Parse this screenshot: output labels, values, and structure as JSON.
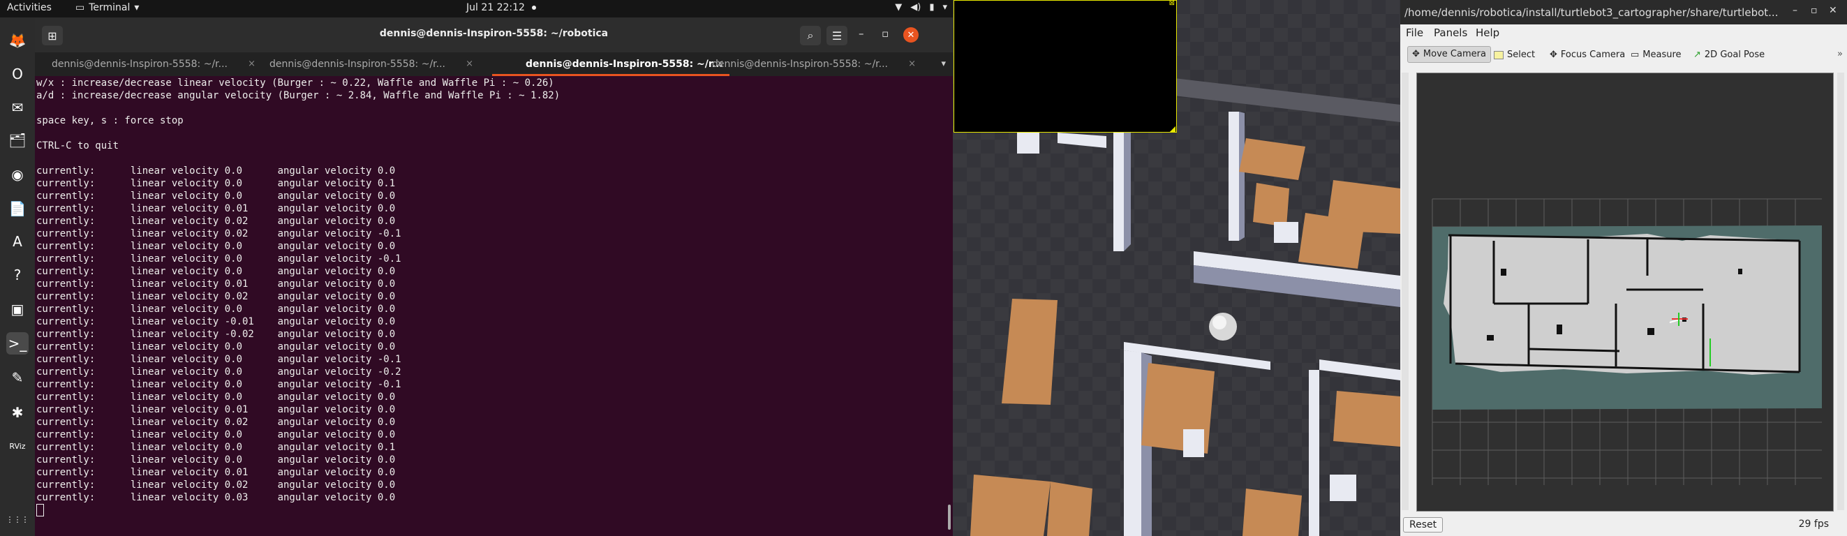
{
  "topbar": {
    "activities": "Activities",
    "app": "Terminal",
    "app_chevron": "▾",
    "clock": "Jul 21  22:12"
  },
  "dock": {
    "items": [
      {
        "name": "firefox-icon",
        "glyph": "🦊"
      },
      {
        "name": "opera-icon",
        "glyph": "O"
      },
      {
        "name": "thunderbird-icon",
        "glyph": "✉"
      },
      {
        "name": "files-icon",
        "glyph": "🗂"
      },
      {
        "name": "rhythmbox-icon",
        "glyph": "◉"
      },
      {
        "name": "writer-icon",
        "glyph": "📄"
      },
      {
        "name": "software-icon",
        "glyph": "A"
      },
      {
        "name": "help-icon",
        "glyph": "?"
      },
      {
        "name": "monitor-icon",
        "glyph": "▣"
      },
      {
        "name": "terminal-icon",
        "glyph": ">_"
      },
      {
        "name": "text-editor-icon",
        "glyph": "✎"
      },
      {
        "name": "gazebo-icon",
        "glyph": "✱"
      },
      {
        "name": "rviz-icon",
        "glyph": "RViz"
      },
      {
        "name": "show-apps-icon",
        "glyph": "⋮⋮⋮"
      }
    ]
  },
  "terminal": {
    "title": "dennis@dennis-Inspiron-5558: ~/robotica",
    "tabs": [
      "dennis@dennis-Inspiron-5558: ~/r...",
      "dennis@dennis-Inspiron-5558: ~/r...",
      "dennis@dennis-Inspiron-5558: ~/r...",
      "dennis@dennis-Inspiron-5558: ~/r..."
    ],
    "tab_close": "×",
    "lines": [
      "w/x : increase/decrease linear velocity (Burger : ~ 0.22, Waffle and Waffle Pi : ~ 0.26)",
      "a/d : increase/decrease angular velocity (Burger : ~ 2.84, Waffle and Waffle Pi : ~ 1.82)",
      "",
      "space key, s : force stop",
      "",
      "CTRL-C to quit",
      "",
      "currently:      linear velocity 0.0      angular velocity 0.0",
      "currently:      linear velocity 0.0      angular velocity 0.1",
      "currently:      linear velocity 0.0      angular velocity 0.0",
      "currently:      linear velocity 0.01     angular velocity 0.0",
      "currently:      linear velocity 0.02     angular velocity 0.0",
      "currently:      linear velocity 0.02     angular velocity -0.1",
      "currently:      linear velocity 0.0      angular velocity 0.0",
      "currently:      linear velocity 0.0      angular velocity -0.1",
      "currently:      linear velocity 0.0      angular velocity 0.0",
      "currently:      linear velocity 0.01     angular velocity 0.0",
      "currently:      linear velocity 0.02     angular velocity 0.0",
      "currently:      linear velocity 0.0      angular velocity 0.0",
      "currently:      linear velocity -0.01    angular velocity 0.0",
      "currently:      linear velocity -0.02    angular velocity 0.0",
      "currently:      linear velocity 0.0      angular velocity 0.0",
      "currently:      linear velocity 0.0      angular velocity -0.1",
      "currently:      linear velocity 0.0      angular velocity -0.2",
      "currently:      linear velocity 0.0      angular velocity -0.1",
      "currently:      linear velocity 0.0      angular velocity 0.0",
      "currently:      linear velocity 0.01     angular velocity 0.0",
      "currently:      linear velocity 0.02     angular velocity 0.0",
      "currently:      linear velocity 0.0      angular velocity 0.0",
      "currently:      linear velocity 0.0      angular velocity 0.1",
      "currently:      linear velocity 0.0      angular velocity 0.0",
      "currently:      linear velocity 0.01     angular velocity 0.0",
      "currently:      linear velocity 0.02     angular velocity 0.0",
      "currently:      linear velocity 0.03     angular velocity 0.0"
    ]
  },
  "rviz": {
    "title": "/home/dennis/robotica/install/turtlebot3_cartographer/share/turtlebot...",
    "menu": [
      "File",
      "Panels",
      "Help"
    ],
    "tools": [
      "Move Camera",
      "Select",
      "Focus Camera",
      "Measure",
      "2D Goal Pose"
    ],
    "reset": "Reset",
    "fps": "29 fps"
  },
  "colors": {
    "terminal_bg": "#300a24",
    "ubuntu_orange": "#e95420",
    "overlay_border": "#e8e800"
  }
}
